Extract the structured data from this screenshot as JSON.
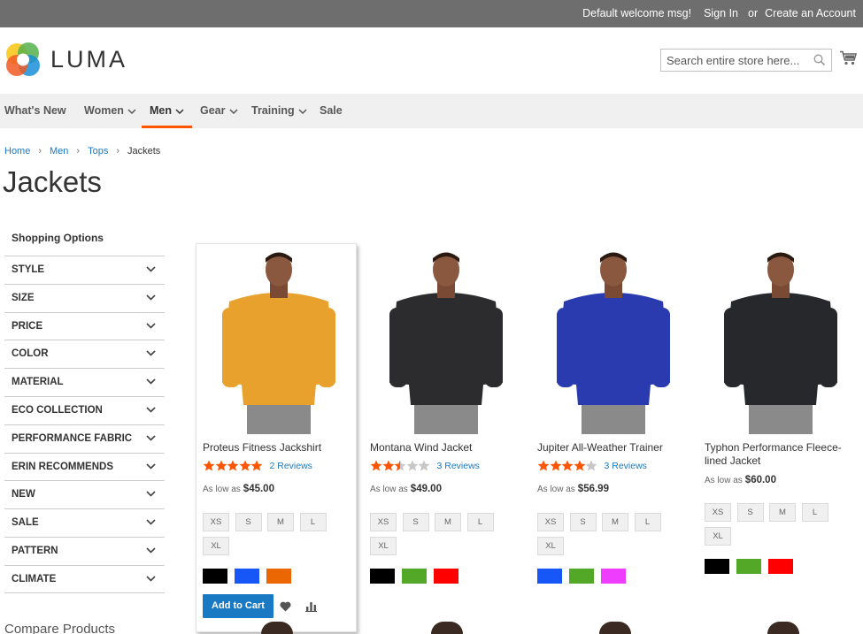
{
  "header": {
    "welcome": "Default welcome msg!",
    "sign_in": "Sign In",
    "or": "or",
    "create_account": "Create an Account",
    "logo_text": "LUMA",
    "search_placeholder": "Search entire store here..."
  },
  "nav": [
    {
      "label": "What's New"
    },
    {
      "label": "Women"
    },
    {
      "label": "Men"
    },
    {
      "label": "Gear"
    },
    {
      "label": "Training"
    },
    {
      "label": "Sale"
    }
  ],
  "breadcrumb": [
    "Home",
    "Men",
    "Tops",
    "Jackets"
  ],
  "page_title": "Jackets",
  "sidebar": {
    "title": "Shopping Options",
    "filters": [
      "STYLE",
      "SIZE",
      "PRICE",
      "COLOR",
      "MATERIAL",
      "ECO COLLECTION",
      "PERFORMANCE FABRIC",
      "ERIN RECOMMENDS",
      "NEW",
      "SALE",
      "PATTERN",
      "CLIMATE"
    ],
    "compare_title": "Compare Products"
  },
  "products": [
    {
      "name": "Proteus Fitness Jackshirt",
      "rating": 5,
      "reviews": "2  Reviews",
      "price_prefix": "As low as",
      "price": "$45.00",
      "sizes": [
        "XS",
        "S",
        "M",
        "L",
        "XL"
      ],
      "colors": [
        "#000000",
        "#1857f7",
        "#eb6703"
      ],
      "shirt": "#e8a12c",
      "add_to_cart": "Add to Cart"
    },
    {
      "name": "Montana Wind Jacket",
      "rating": 2.5,
      "reviews": "3  Reviews",
      "price_prefix": "As low as",
      "price": "$49.00",
      "sizes": [
        "XS",
        "S",
        "M",
        "L",
        "XL"
      ],
      "colors": [
        "#000000",
        "#53a828",
        "#ff0000"
      ],
      "shirt": "#2c2c2e"
    },
    {
      "name": "Jupiter All-Weather Trainer",
      "rating": 4,
      "reviews": "3  Reviews",
      "price_prefix": "As low as",
      "price": "$56.99",
      "sizes": [
        "XS",
        "S",
        "M",
        "L",
        "XL"
      ],
      "colors": [
        "#1857f7",
        "#53a828",
        "#ef3dff"
      ],
      "shirt": "#2a3bb0"
    },
    {
      "name": "Typhon Performance Fleece-lined Jacket",
      "rating": 0,
      "reviews": "",
      "price_prefix": "As low as",
      "price": "$60.00",
      "sizes": [
        "XS",
        "S",
        "M",
        "L",
        "XL"
      ],
      "colors": [
        "#000000",
        "#53a828",
        "#ff0000"
      ],
      "shirt": "#27282c"
    }
  ],
  "colors": {
    "accent": "#ff5501",
    "link": "#1979c3",
    "star": "#ff5501",
    "topbar": "#6e6e6e"
  }
}
